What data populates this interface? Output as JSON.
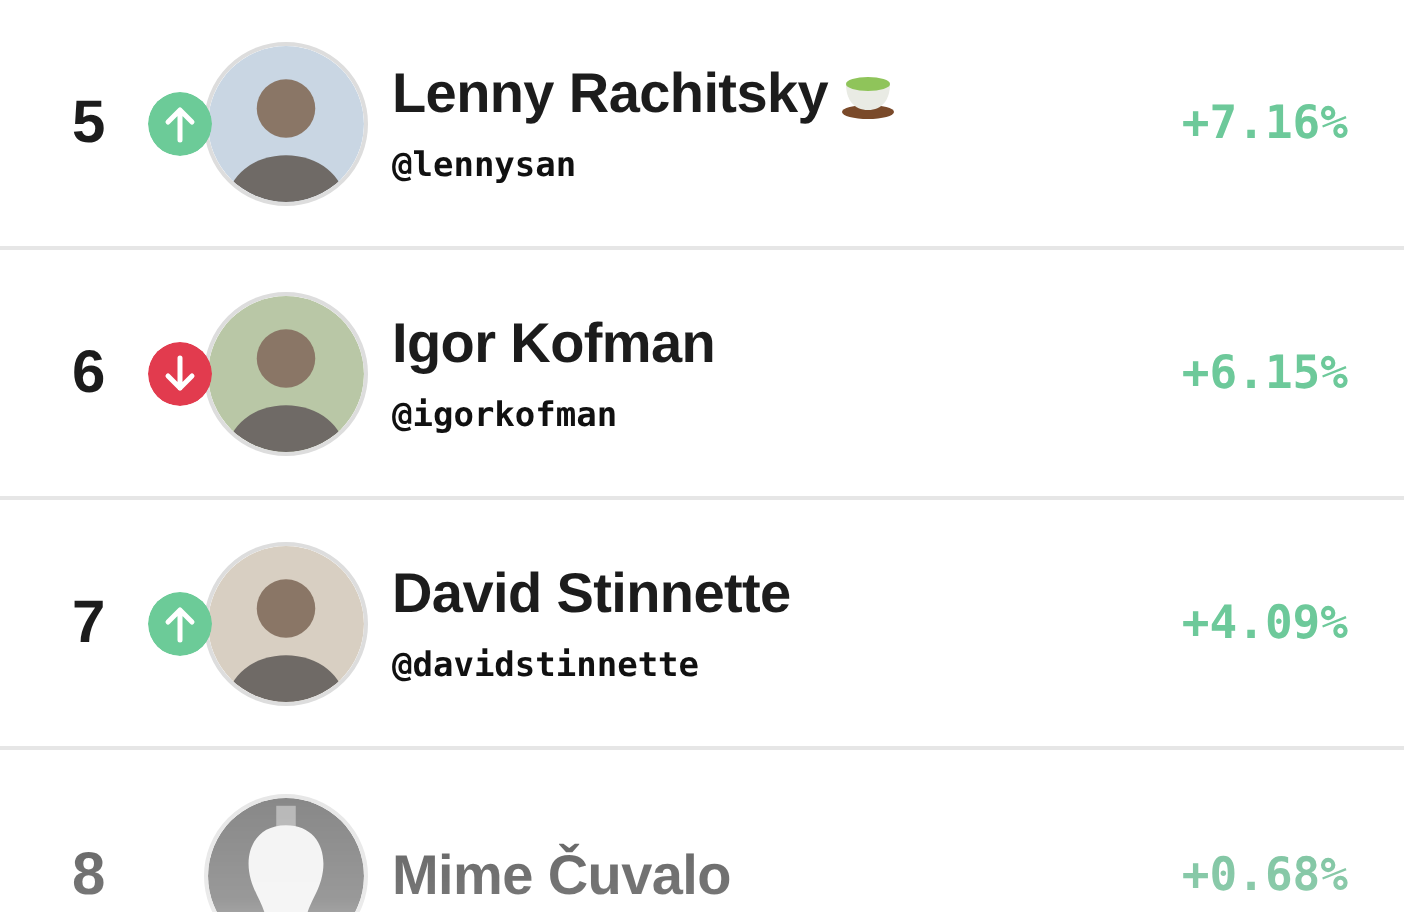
{
  "leaderboard": {
    "rows": [
      {
        "rank": "5",
        "rising": true,
        "avatar": {
          "kind": "person"
        },
        "name": "Lenny Rachitsky",
        "tea_icon": true,
        "handle": "@lennysan",
        "change": "+7.16%",
        "faded": false
      },
      {
        "rank": "6",
        "rising": false,
        "avatar": {
          "kind": "person"
        },
        "name": "Igor Kofman",
        "handle": "@igorkofman",
        "change": "+6.15%",
        "faded": false
      },
      {
        "rank": "7",
        "rising": true,
        "avatar": {
          "kind": "person"
        },
        "name": "David Stinnette",
        "handle": "@davidstinnette",
        "change": "+4.09%",
        "faded": false
      },
      {
        "rank": "8",
        "name": "Mime Čuvalo",
        "change": "+0.68%",
        "faded": true
      }
    ]
  }
}
